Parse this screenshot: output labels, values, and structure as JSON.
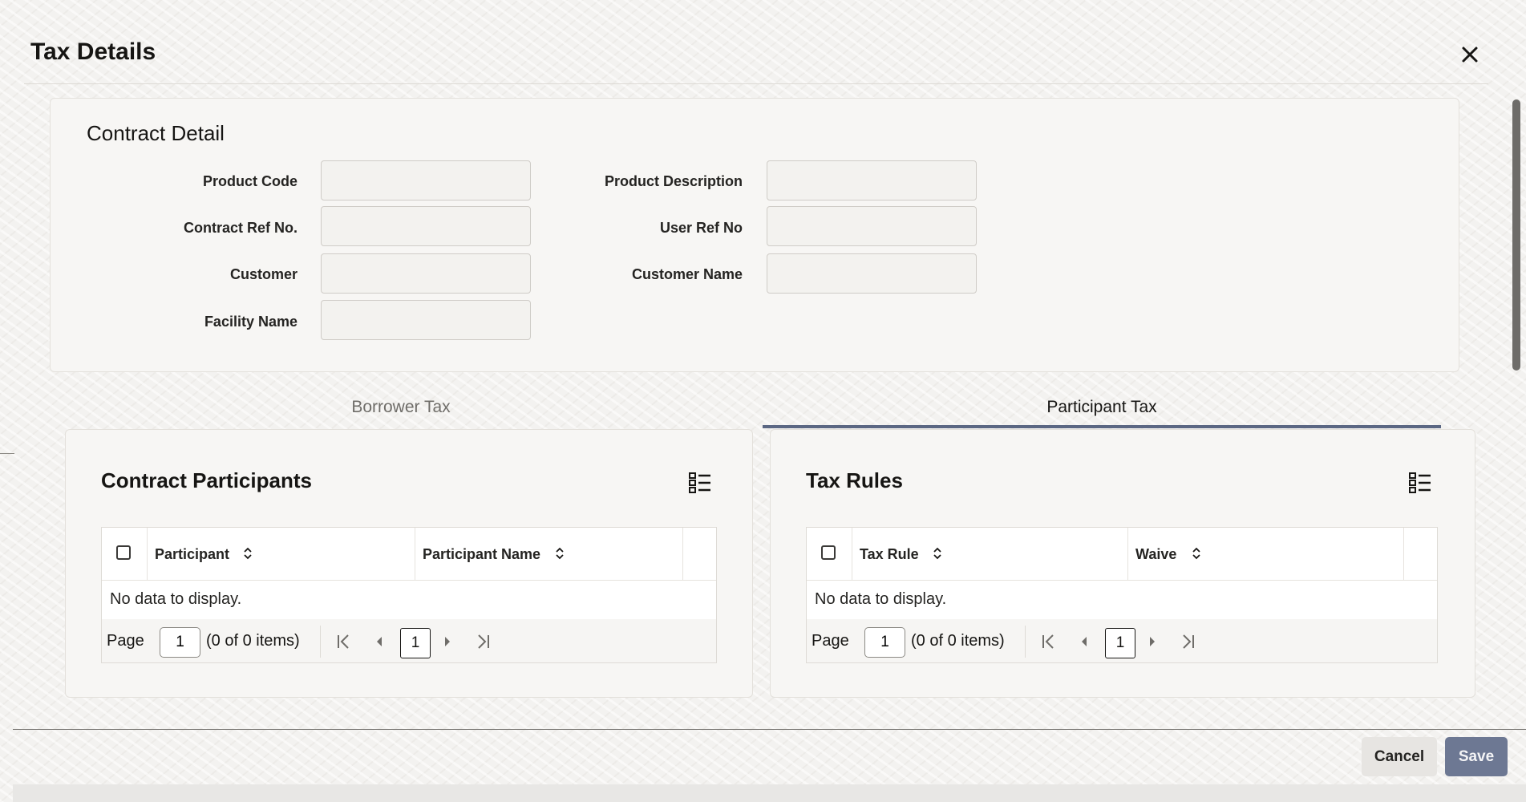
{
  "dialog": {
    "title": "Tax Details"
  },
  "contract_detail": {
    "heading": "Contract Detail",
    "fields": {
      "product_code": {
        "label": "Product Code",
        "value": ""
      },
      "product_description": {
        "label": "Product Description",
        "value": ""
      },
      "contract_ref_no": {
        "label": "Contract Ref No.",
        "value": ""
      },
      "user_ref_no": {
        "label": "User Ref No",
        "value": ""
      },
      "customer": {
        "label": "Customer",
        "value": ""
      },
      "customer_name": {
        "label": "Customer Name",
        "value": ""
      },
      "facility_name": {
        "label": "Facility Name",
        "value": ""
      }
    }
  },
  "tabs": [
    {
      "label": "Borrower Tax",
      "active": false
    },
    {
      "label": "Participant Tax",
      "active": true
    }
  ],
  "participants_panel": {
    "title": "Contract Participants",
    "columns": [
      "Participant",
      "Participant Name"
    ],
    "empty_text": "No data to display.",
    "pager": {
      "label": "Page",
      "page_value": "1",
      "count_text": "(0 of 0 items)",
      "current_page": "1"
    }
  },
  "tax_rules_panel": {
    "title": "Tax Rules",
    "columns": [
      "Tax Rule",
      "Waive"
    ],
    "empty_text": "No data to display.",
    "pager": {
      "label": "Page",
      "page_value": "1",
      "count_text": "(0 of 0 items)",
      "current_page": "1"
    }
  },
  "footer": {
    "cancel_label": "Cancel",
    "save_label": "Save"
  },
  "colors": {
    "accent": "#5b6783",
    "save_button": "#6d7893",
    "text": "#161513"
  }
}
